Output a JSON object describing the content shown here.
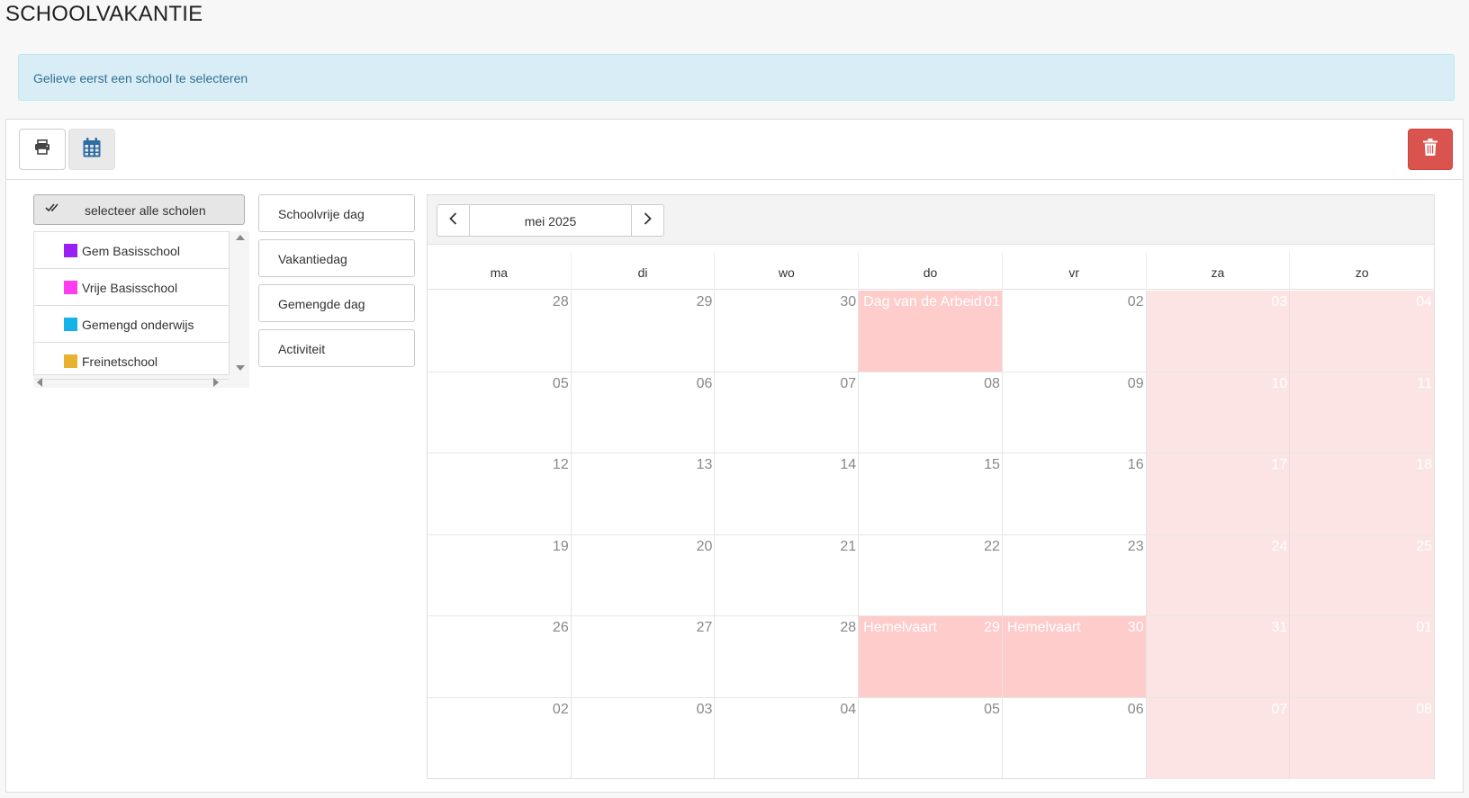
{
  "page_title": "SCHOOLVAKANTIE",
  "alert_text": "Gelieve eerst een school te selecteren",
  "toolbar": {
    "print_icon": "print-icon",
    "calendar_icon": "calendar-icon",
    "delete_icon": "trash-icon"
  },
  "schools": {
    "select_all_label": "selecteer alle scholen",
    "items": [
      {
        "name": "Gem Basisschool",
        "color": "#9a1ff5"
      },
      {
        "name": "Vrije Basisschool",
        "color": "#ff3df0"
      },
      {
        "name": "Gemengd onderwijs",
        "color": "#15b4e8"
      },
      {
        "name": "Freinetschool",
        "color": "#e7b32f"
      }
    ]
  },
  "day_types": [
    "Schoolvrije dag",
    "Vakantiedag",
    "Gemengde dag",
    "Activiteit"
  ],
  "calendar": {
    "month_label": "mei 2025",
    "weekdays": [
      "ma",
      "di",
      "wo",
      "do",
      "vr",
      "za",
      "zo"
    ],
    "weeks": [
      [
        {
          "d": "28"
        },
        {
          "d": "29"
        },
        {
          "d": "30"
        },
        {
          "d": "01",
          "holiday": "Dag van de Arbeid"
        },
        {
          "d": "02"
        },
        {
          "d": "03"
        },
        {
          "d": "04"
        }
      ],
      [
        {
          "d": "05"
        },
        {
          "d": "06"
        },
        {
          "d": "07"
        },
        {
          "d": "08"
        },
        {
          "d": "09"
        },
        {
          "d": "10"
        },
        {
          "d": "11"
        }
      ],
      [
        {
          "d": "12"
        },
        {
          "d": "13"
        },
        {
          "d": "14"
        },
        {
          "d": "15"
        },
        {
          "d": "16"
        },
        {
          "d": "17"
        },
        {
          "d": "18"
        }
      ],
      [
        {
          "d": "19"
        },
        {
          "d": "20"
        },
        {
          "d": "21"
        },
        {
          "d": "22"
        },
        {
          "d": "23"
        },
        {
          "d": "24"
        },
        {
          "d": "25"
        }
      ],
      [
        {
          "d": "26"
        },
        {
          "d": "27"
        },
        {
          "d": "28"
        },
        {
          "d": "29",
          "holiday": "Hemelvaart"
        },
        {
          "d": "30",
          "holiday": "Hemelvaart"
        },
        {
          "d": "31"
        },
        {
          "d": "01"
        }
      ],
      [
        {
          "d": "02"
        },
        {
          "d": "03"
        },
        {
          "d": "04"
        },
        {
          "d": "05"
        },
        {
          "d": "06"
        },
        {
          "d": "07"
        },
        {
          "d": "08"
        }
      ]
    ]
  },
  "colors": {
    "weekend": "#fce4e4",
    "holiday": "#ffcccc",
    "danger": "#d9534f",
    "alert_bg": "#d9edf7"
  }
}
